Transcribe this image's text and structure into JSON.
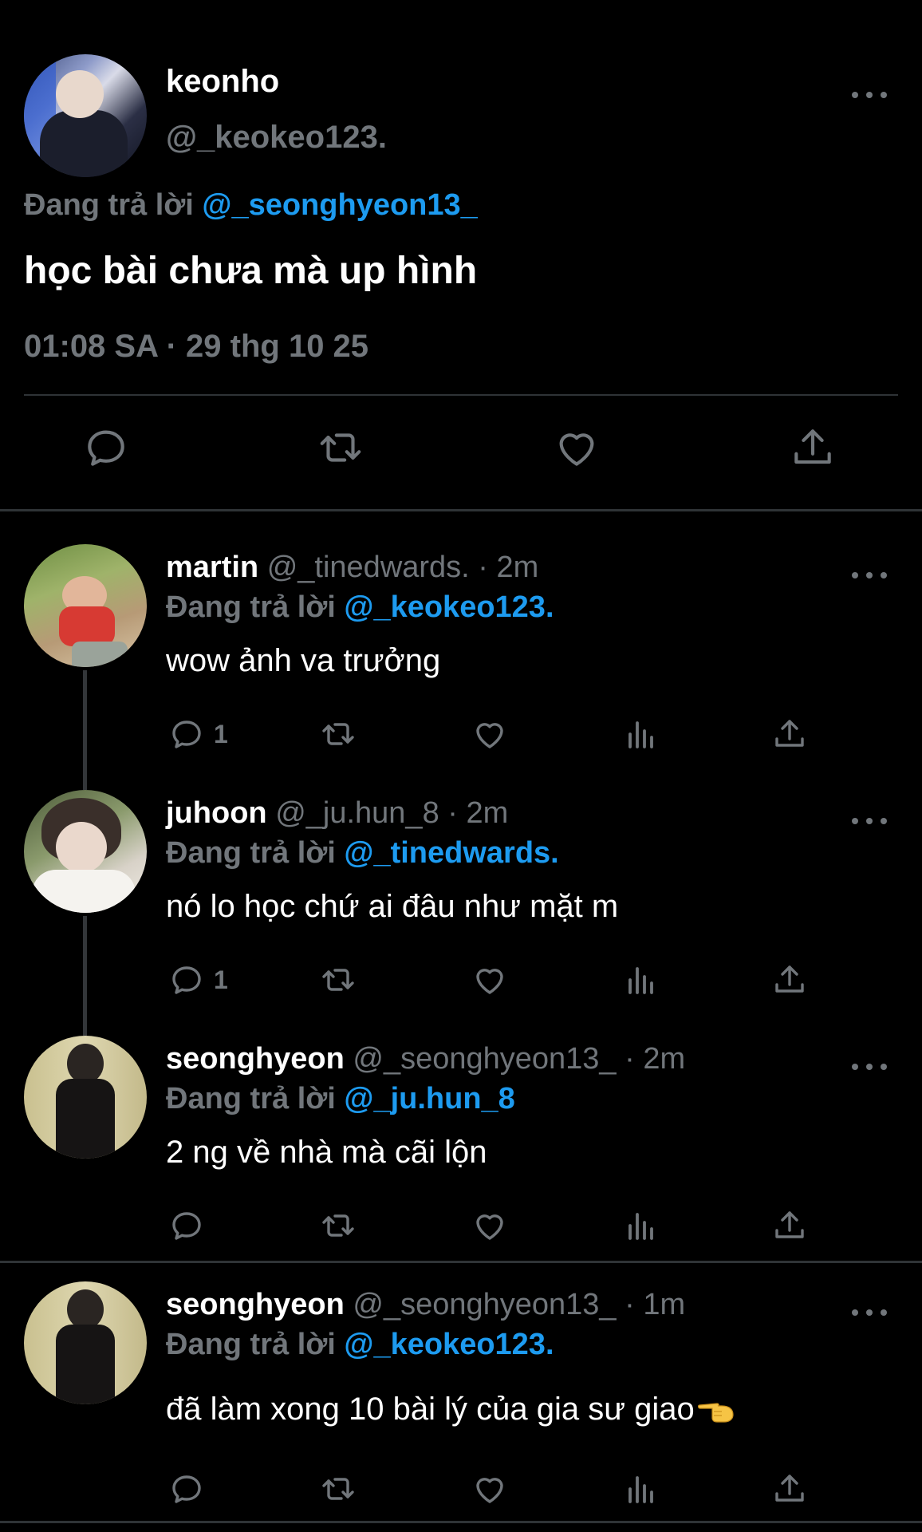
{
  "main_tweet": {
    "author_name": "keonho",
    "author_handle": "@_keokeo123.",
    "replying_prefix": "Đang trả lời",
    "replying_to": "@_seonghyeon13_",
    "text": "học bài chưa mà up hình",
    "timestamp": "01:08 SA · 29 thg 10 25",
    "actions": [
      "reply-icon",
      "retweet-icon",
      "like-icon",
      "share-icon"
    ]
  },
  "replies": [
    {
      "name": "martin",
      "handle": "@_tinedwards.",
      "sep": " · ",
      "time": "2m",
      "replying_prefix": "Đang trả lời",
      "replying_to": "@_keokeo123.",
      "text": "wow ảnh va trưởng",
      "reply_count": "1"
    },
    {
      "name": "juhoon",
      "handle": "@_ju.hun_8",
      "sep": " · ",
      "time": "2m",
      "replying_prefix": "Đang trả lời",
      "replying_to": "@_tinedwards.",
      "text": "nó lo học chứ ai đâu như mặt m",
      "reply_count": "1"
    },
    {
      "name": "seonghyeon",
      "handle": "@_seonghyeon13_",
      "sep": " · ",
      "time": "2m",
      "replying_prefix": "Đang trả lời",
      "replying_to": "@_ju.hun_8",
      "text": "2 ng về nhà mà cãi lộn",
      "reply_count": ""
    },
    {
      "name": "seonghyeon",
      "handle": "@_seonghyeon13_",
      "sep": " · ",
      "time": "1m",
      "replying_prefix": "Đang trả lời",
      "replying_to": "@_keokeo123.",
      "text": "đã làm xong 10 bài lý của gia sư giao",
      "emoji": "pointing-hand-emoji",
      "reply_count": ""
    }
  ],
  "colors": {
    "background": "#000000",
    "text": "#ffffff",
    "muted": "#71767b",
    "mention": "#1d9bf0",
    "divider": "#2f3336"
  }
}
